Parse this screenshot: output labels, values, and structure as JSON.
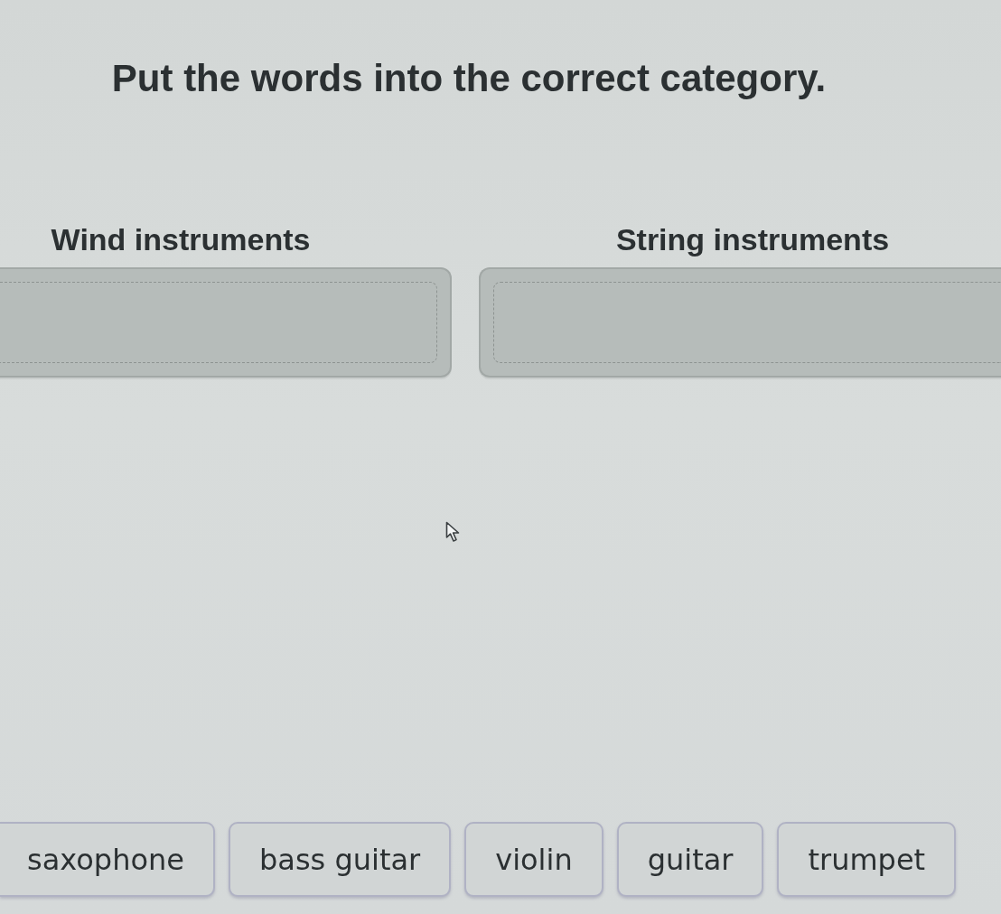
{
  "instruction": "Put the words into the correct category.",
  "categories": [
    {
      "label": "Wind instruments"
    },
    {
      "label": "String instruments"
    }
  ],
  "word_bank": [
    {
      "text": "saxophone"
    },
    {
      "text": "bass guitar"
    },
    {
      "text": "violin"
    },
    {
      "text": "guitar"
    },
    {
      "text": "trumpet"
    }
  ]
}
